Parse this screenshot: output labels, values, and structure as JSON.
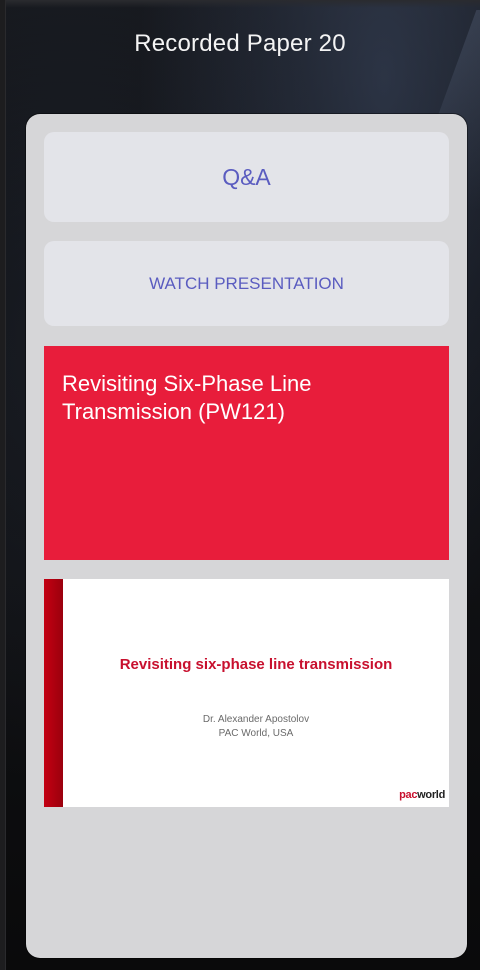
{
  "header": {
    "title": "Recorded Paper 20"
  },
  "panel": {
    "qa_label": "Q&A",
    "watch_label": "WATCH PRESENTATION",
    "banner_title": "Revisiting Six-Phase Line Transmission (PW121)"
  },
  "thumbnail": {
    "slide_title": "Revisiting six-phase line transmission",
    "author": "Dr. Alexander Apostolov",
    "affiliation": "PAC World, USA",
    "logo_pac": "pac",
    "logo_world": "world"
  },
  "colors": {
    "accent_blue": "#5a5cc0",
    "banner_red": "#e81d3b",
    "panel_gray": "#d6d6d8"
  }
}
